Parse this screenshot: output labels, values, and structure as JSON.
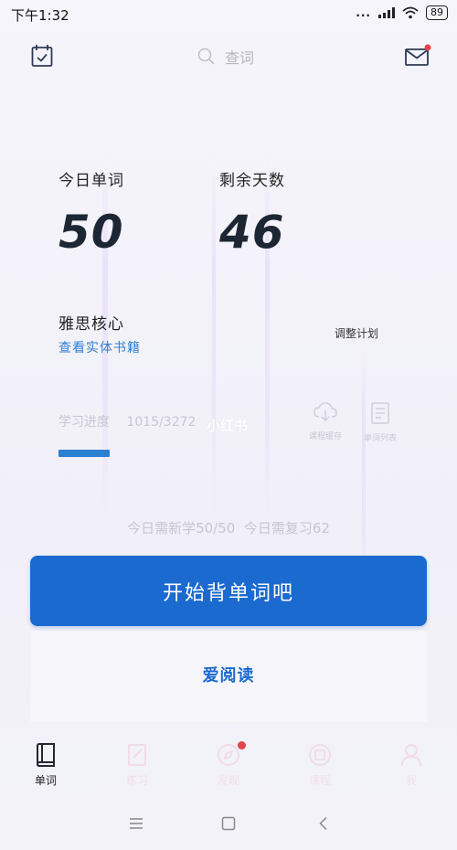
{
  "status_bar": {
    "time": "下午1:32",
    "dots": "...",
    "battery": "89"
  },
  "header": {
    "search_placeholder": "查词",
    "icons": [
      "calendar-check-icon",
      "search-icon",
      "mail-icon"
    ],
    "mail_has_notification": true
  },
  "stats": {
    "today_words_label": "今日单词",
    "today_words_value": "50",
    "days_left_label": "剩余天数",
    "days_left_value": "46"
  },
  "book": {
    "name": "雅思核心",
    "view_physical_link": "查看实体书籍",
    "adjust_plan": "调整计划"
  },
  "progress": {
    "label": "学习进度",
    "value_text": "1015/3272",
    "fraction": 0.31,
    "watermark": "小红书",
    "actions": [
      {
        "icon": "cloud-download-icon",
        "label": "课程缓存"
      },
      {
        "icon": "document-icon",
        "label": "单词列表"
      }
    ]
  },
  "today_summary": "今日需新学50/50  今日需复习62",
  "primary_action": "开始背单词吧",
  "reading_link": "爱阅读",
  "bottom_nav": [
    {
      "label": "单词",
      "icon": "book-icon",
      "active": true
    },
    {
      "label": "练习",
      "icon": "note-icon",
      "active": false
    },
    {
      "label": "发现",
      "icon": "compass-icon",
      "active": false,
      "badge": true
    },
    {
      "label": "课程",
      "icon": "course-icon",
      "active": false
    },
    {
      "label": "我",
      "icon": "person-icon",
      "active": false
    }
  ],
  "colors": {
    "accent": "#1a6ad0",
    "link": "#2f7fd1",
    "badge": "#e0454b",
    "background": "#f3f2f9"
  }
}
